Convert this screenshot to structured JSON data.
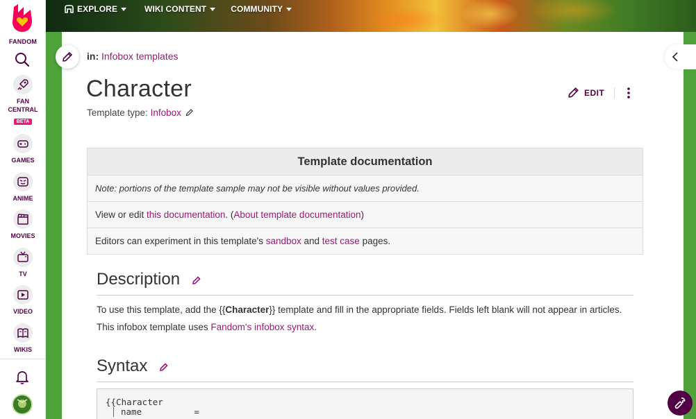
{
  "colors": {
    "brand": "#520044",
    "link": "#9c1778",
    "accent": "#ea1b7a",
    "wiki_green": "#4fa33a"
  },
  "global_nav": {
    "logo_label": "FANDOM",
    "items": [
      {
        "label_1": "FAN",
        "label_2": "CENTRAL",
        "badge": "BETA",
        "icon": "rocket-icon"
      },
      {
        "label": "GAMES",
        "icon": "gamepad-icon"
      },
      {
        "label": "ANIME",
        "icon": "anime-face-icon"
      },
      {
        "label": "MOVIES",
        "icon": "clapperboard-icon"
      },
      {
        "label": "TV",
        "icon": "tv-icon"
      },
      {
        "label": "VIDEO",
        "icon": "play-icon"
      },
      {
        "label": "WIKIS",
        "icon": "book-icon"
      }
    ]
  },
  "top_nav": {
    "explore": "EXPLORE",
    "wiki_content": "WIKI CONTENT",
    "community": "COMMUNITY"
  },
  "page": {
    "breadcrumb_prefix": "in:",
    "breadcrumb_link": "Infobox templates",
    "title": "Character",
    "template_type_label": "Template type:",
    "template_type_value": "Infobox",
    "edit_label": "EDIT"
  },
  "doc_box": {
    "header": "Template documentation",
    "note": "Note: portions of the template sample may not be visible without values provided.",
    "row2_pre": "View or edit ",
    "row2_link1": "this documentation",
    "row2_mid": ". (",
    "row2_link2": "About template documentation",
    "row2_post": ")",
    "row3_pre": "Editors can experiment in this template's ",
    "row3_link1": "sandbox",
    "row3_mid": " and ",
    "row3_link2": "test case",
    "row3_post": " pages."
  },
  "description": {
    "heading": "Description",
    "p1": "To use this template, add the {{",
    "p1_bold": "Character",
    "p2": "}} template and fill in the appropriate fields. Fields left blank will not appear in articles. This infobox template uses ",
    "p_link": "Fandom's infobox syntax",
    "p3": "."
  },
  "syntax": {
    "heading": "Syntax",
    "line1": "{{Character",
    "line2": "name          ="
  }
}
